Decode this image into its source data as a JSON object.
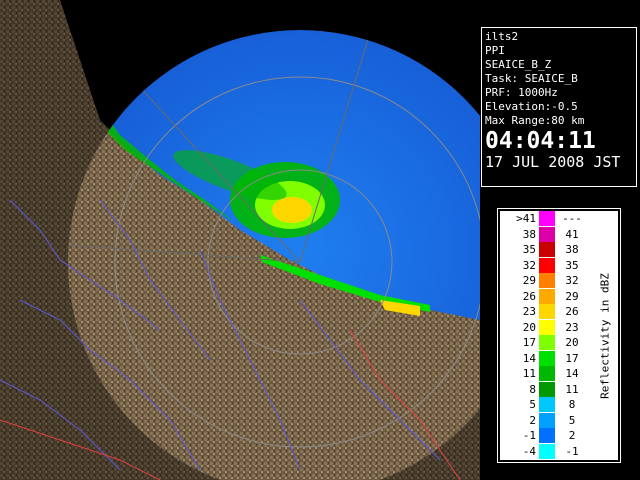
{
  "info": {
    "radar_id": "ilts2",
    "scan_type": "PPI",
    "product": "SEAICE_B_Z",
    "task": "Task: SEAICE_B",
    "prf": "PRF: 1000Hz",
    "elevation": "Elevation:-0.5",
    "max_range": "Max Range:80 km",
    "time": "04:04:11",
    "date": "17 JUL 2008 JST"
  },
  "legend": {
    "unit_label": "Reflectivity in dBZ",
    "rows": [
      {
        "low": ">41",
        "high": "---",
        "color": "#ff00ff"
      },
      {
        "low": "38",
        "high": "41",
        "color": "#dd00aa"
      },
      {
        "low": "35",
        "high": "38",
        "color": "#c80000"
      },
      {
        "low": "32",
        "high": "35",
        "color": "#ff0000"
      },
      {
        "low": "29",
        "high": "32",
        "color": "#ff7f00"
      },
      {
        "low": "26",
        "high": "29",
        "color": "#ffaa00"
      },
      {
        "low": "23",
        "high": "26",
        "color": "#ffd700"
      },
      {
        "low": "20",
        "high": "23",
        "color": "#ffff00"
      },
      {
        "low": "17",
        "high": "20",
        "color": "#7fff00"
      },
      {
        "low": "14",
        "high": "17",
        "color": "#00e000"
      },
      {
        "low": "11",
        "high": "14",
        "color": "#00b800"
      },
      {
        "low": "8",
        "high": "11",
        "color": "#009a00"
      },
      {
        "low": "5",
        "high": "8",
        "color": "#00c8ff"
      },
      {
        "low": "2",
        "high": "5",
        "color": "#00a0ff"
      },
      {
        "low": "-1",
        "high": "2",
        "color": "#0070ff"
      },
      {
        "low": "-4",
        "high": "-1",
        "color": "#00ffff"
      }
    ]
  },
  "colors": {
    "sea_clutter": "#1a6ee6",
    "land": "#7a6448",
    "background": "#000000",
    "range_ring": "#8a8a8a"
  }
}
